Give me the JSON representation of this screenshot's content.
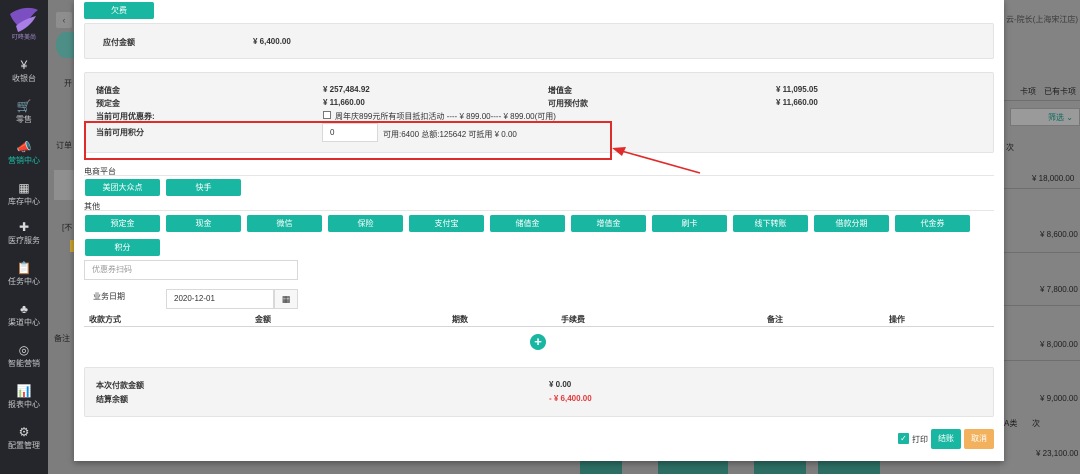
{
  "sidebar": {
    "logo_text": "叮咚美尚",
    "items": [
      {
        "icon": "yen-icon",
        "glyph": "¥",
        "label": "收银台"
      },
      {
        "icon": "cart-icon",
        "glyph": "🛒",
        "label": "零售"
      },
      {
        "icon": "megaphone-icon",
        "glyph": "📣",
        "label": "营销中心",
        "active": true
      },
      {
        "icon": "grid-icon",
        "glyph": "▦",
        "label": "库存中心"
      },
      {
        "icon": "medical-kit-icon",
        "glyph": "✚",
        "label": "医疗服务"
      },
      {
        "icon": "clipboard-icon",
        "glyph": "📋",
        "label": "任务中心"
      },
      {
        "icon": "hierarchy-icon",
        "glyph": "♣",
        "label": "渠道中心"
      },
      {
        "icon": "target-icon",
        "glyph": "◎",
        "label": "智能营销"
      },
      {
        "icon": "bar-chart-icon",
        "glyph": "📊",
        "label": "报表中心"
      },
      {
        "icon": "gear-icon",
        "glyph": "⚙",
        "label": "配置管理"
      }
    ]
  },
  "background": {
    "top_right_text": "云-院长(上海宋江店)",
    "left_texts": [
      "开",
      "订单",
      "[不",
      "备注"
    ],
    "tabs": [
      "卡项",
      "已有卡项"
    ],
    "filter_label": "筛选",
    "col_labels": [
      "次",
      "A类",
      "次"
    ],
    "amounts": [
      "¥ 18,000.00",
      "¥ 8,600.00",
      "¥ 7,800.00",
      "¥ 8,000.00",
      "¥ 9,000.00",
      "¥ 23,100.00"
    ]
  },
  "modal": {
    "debt_tab": "欠费",
    "payable_label": "应付金额",
    "payable_value": "¥ 6,400.00",
    "balances": {
      "stored_label": "储值金",
      "stored_value": "¥ 257,484.92",
      "bonus_label": "增值金",
      "bonus_value": "¥ 11,095.05",
      "deposit_label": "预定金",
      "deposit_value": "¥ 11,660.00",
      "avail_deposit_label": "可用预付款",
      "avail_deposit_value": "¥ 11,660.00",
      "coupon_label": "当前可用优惠券:",
      "coupon_text": "周年庆899元所有项目抵扣活动 ---- ¥ 899.00---- ¥ 899.00(可用)"
    },
    "points": {
      "label": "当前可用积分",
      "input_value": "0",
      "summary": "可用:6400 总额:125642 可抵用 ¥ 0.00"
    },
    "ecommerce_label": "电商平台",
    "ecommerce_buttons": [
      "美团大众点",
      "快手"
    ],
    "other_label": "其他",
    "payment_buttons": [
      "预定金",
      "现金",
      "微信",
      "保险",
      "支付宝",
      "储值金",
      "增值金",
      "刷卡",
      "线下转账",
      "借款分期",
      "代金券",
      "积分"
    ],
    "coupon_scan_placeholder": "优惠券扫码",
    "business_date_label": "业务日期",
    "business_date_value": "2020-12-01",
    "table_headers": [
      "收款方式",
      "金额",
      "期数",
      "手续费",
      "备注",
      "操作"
    ],
    "summary": {
      "this_pay_label": "本次付款金额",
      "this_pay_value": "¥ 0.00",
      "remain_label": "结算余额",
      "remain_value": "- ¥ 6,400.00"
    },
    "print_label": "打印",
    "settle_button": "结账",
    "cancel_button": "取消"
  },
  "colors": {
    "accent": "#19b7a2",
    "danger": "#e3393c",
    "cancel": "#f3b15d",
    "sidebar": "#24262b"
  }
}
